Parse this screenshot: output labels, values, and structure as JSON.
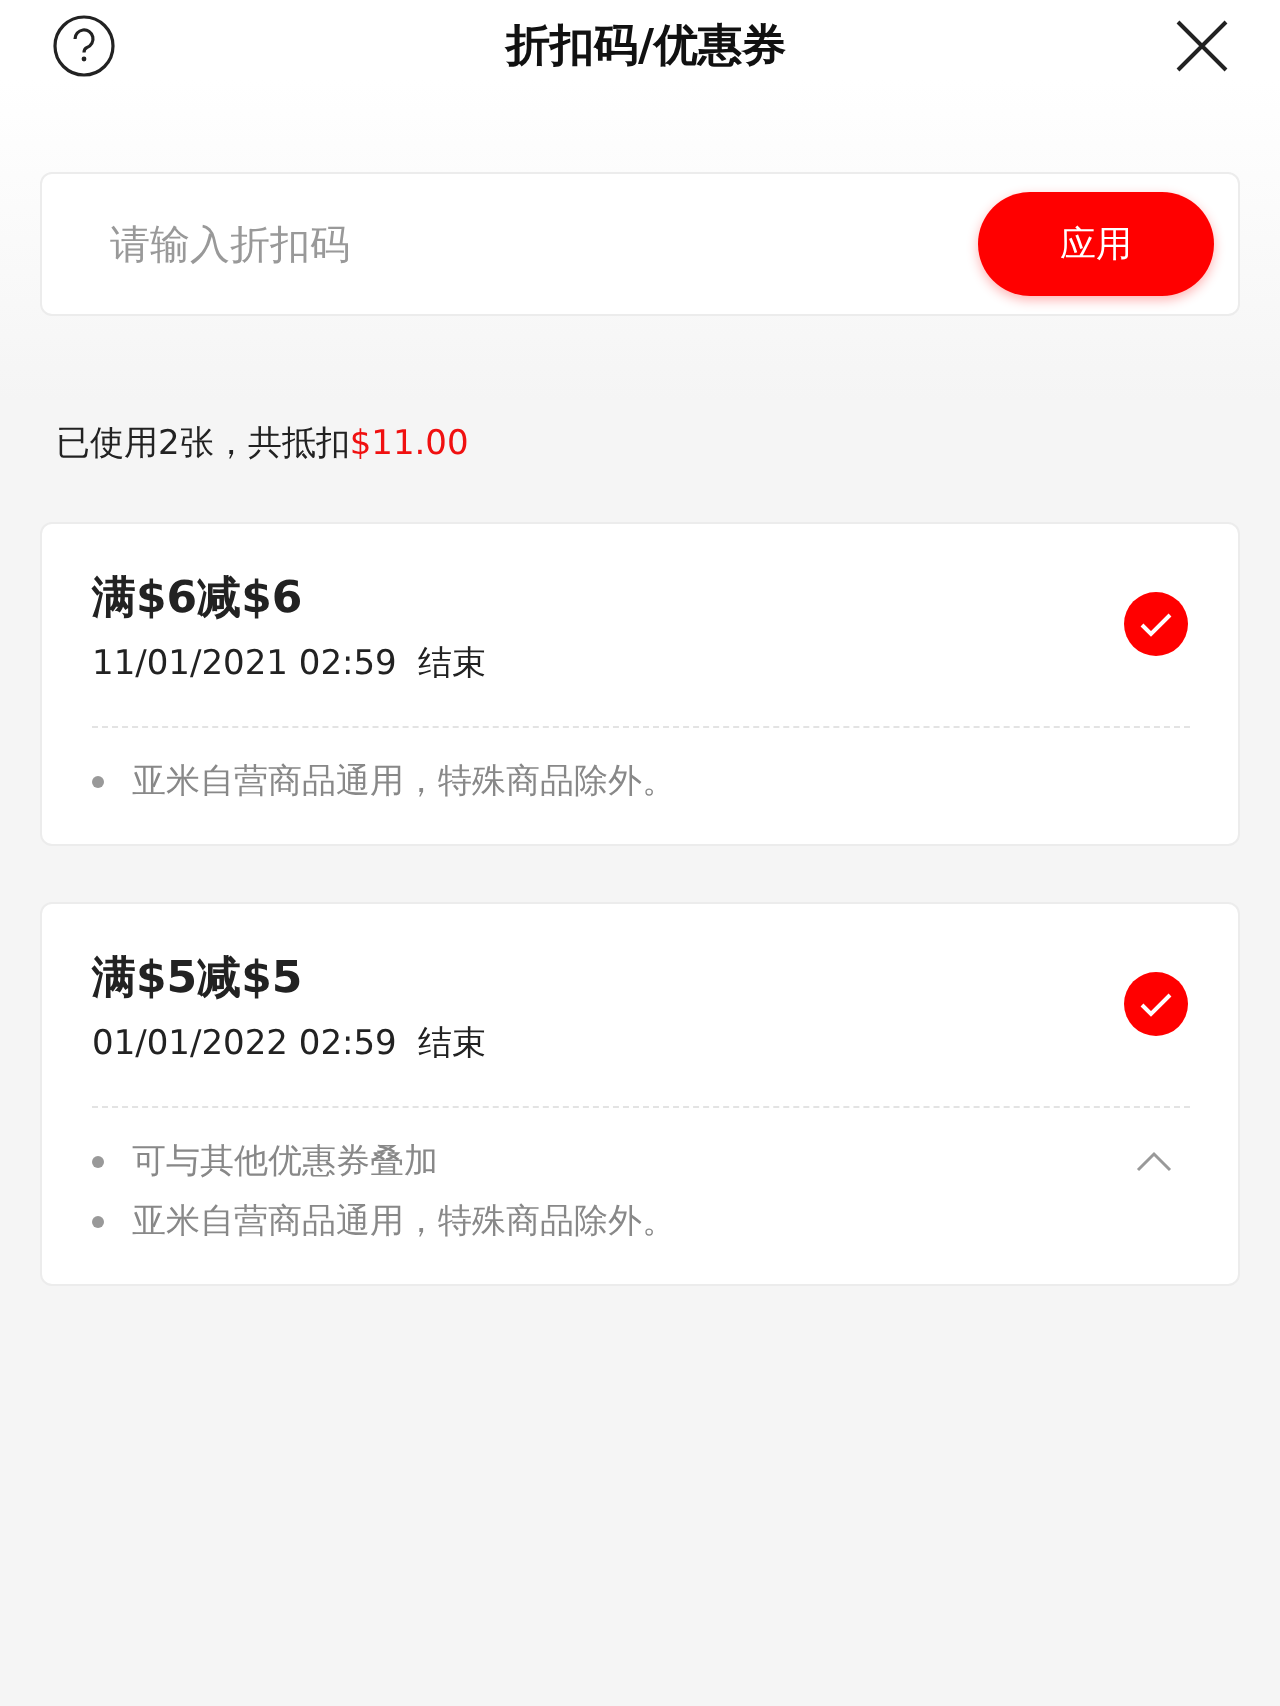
{
  "header": {
    "title": "折扣码/优惠券"
  },
  "code_input": {
    "placeholder": "请输入折扣码",
    "button": "应用"
  },
  "summary": {
    "text": "已使用2张，共抵扣",
    "amount": "$11.00"
  },
  "coupons": [
    {
      "title": "满$6减$6",
      "expiry": "11/01/2021 02:59  结束",
      "checked": true,
      "notes": [
        "亚米自营商品通用，特殊商品除外。"
      ]
    },
    {
      "title": "满$5减$5",
      "expiry": "01/01/2022 02:59  结束",
      "checked": true,
      "expanded": true,
      "notes": [
        "可与其他优惠券叠加",
        "亚米自营商品通用，特殊商品除外。"
      ]
    }
  ]
}
